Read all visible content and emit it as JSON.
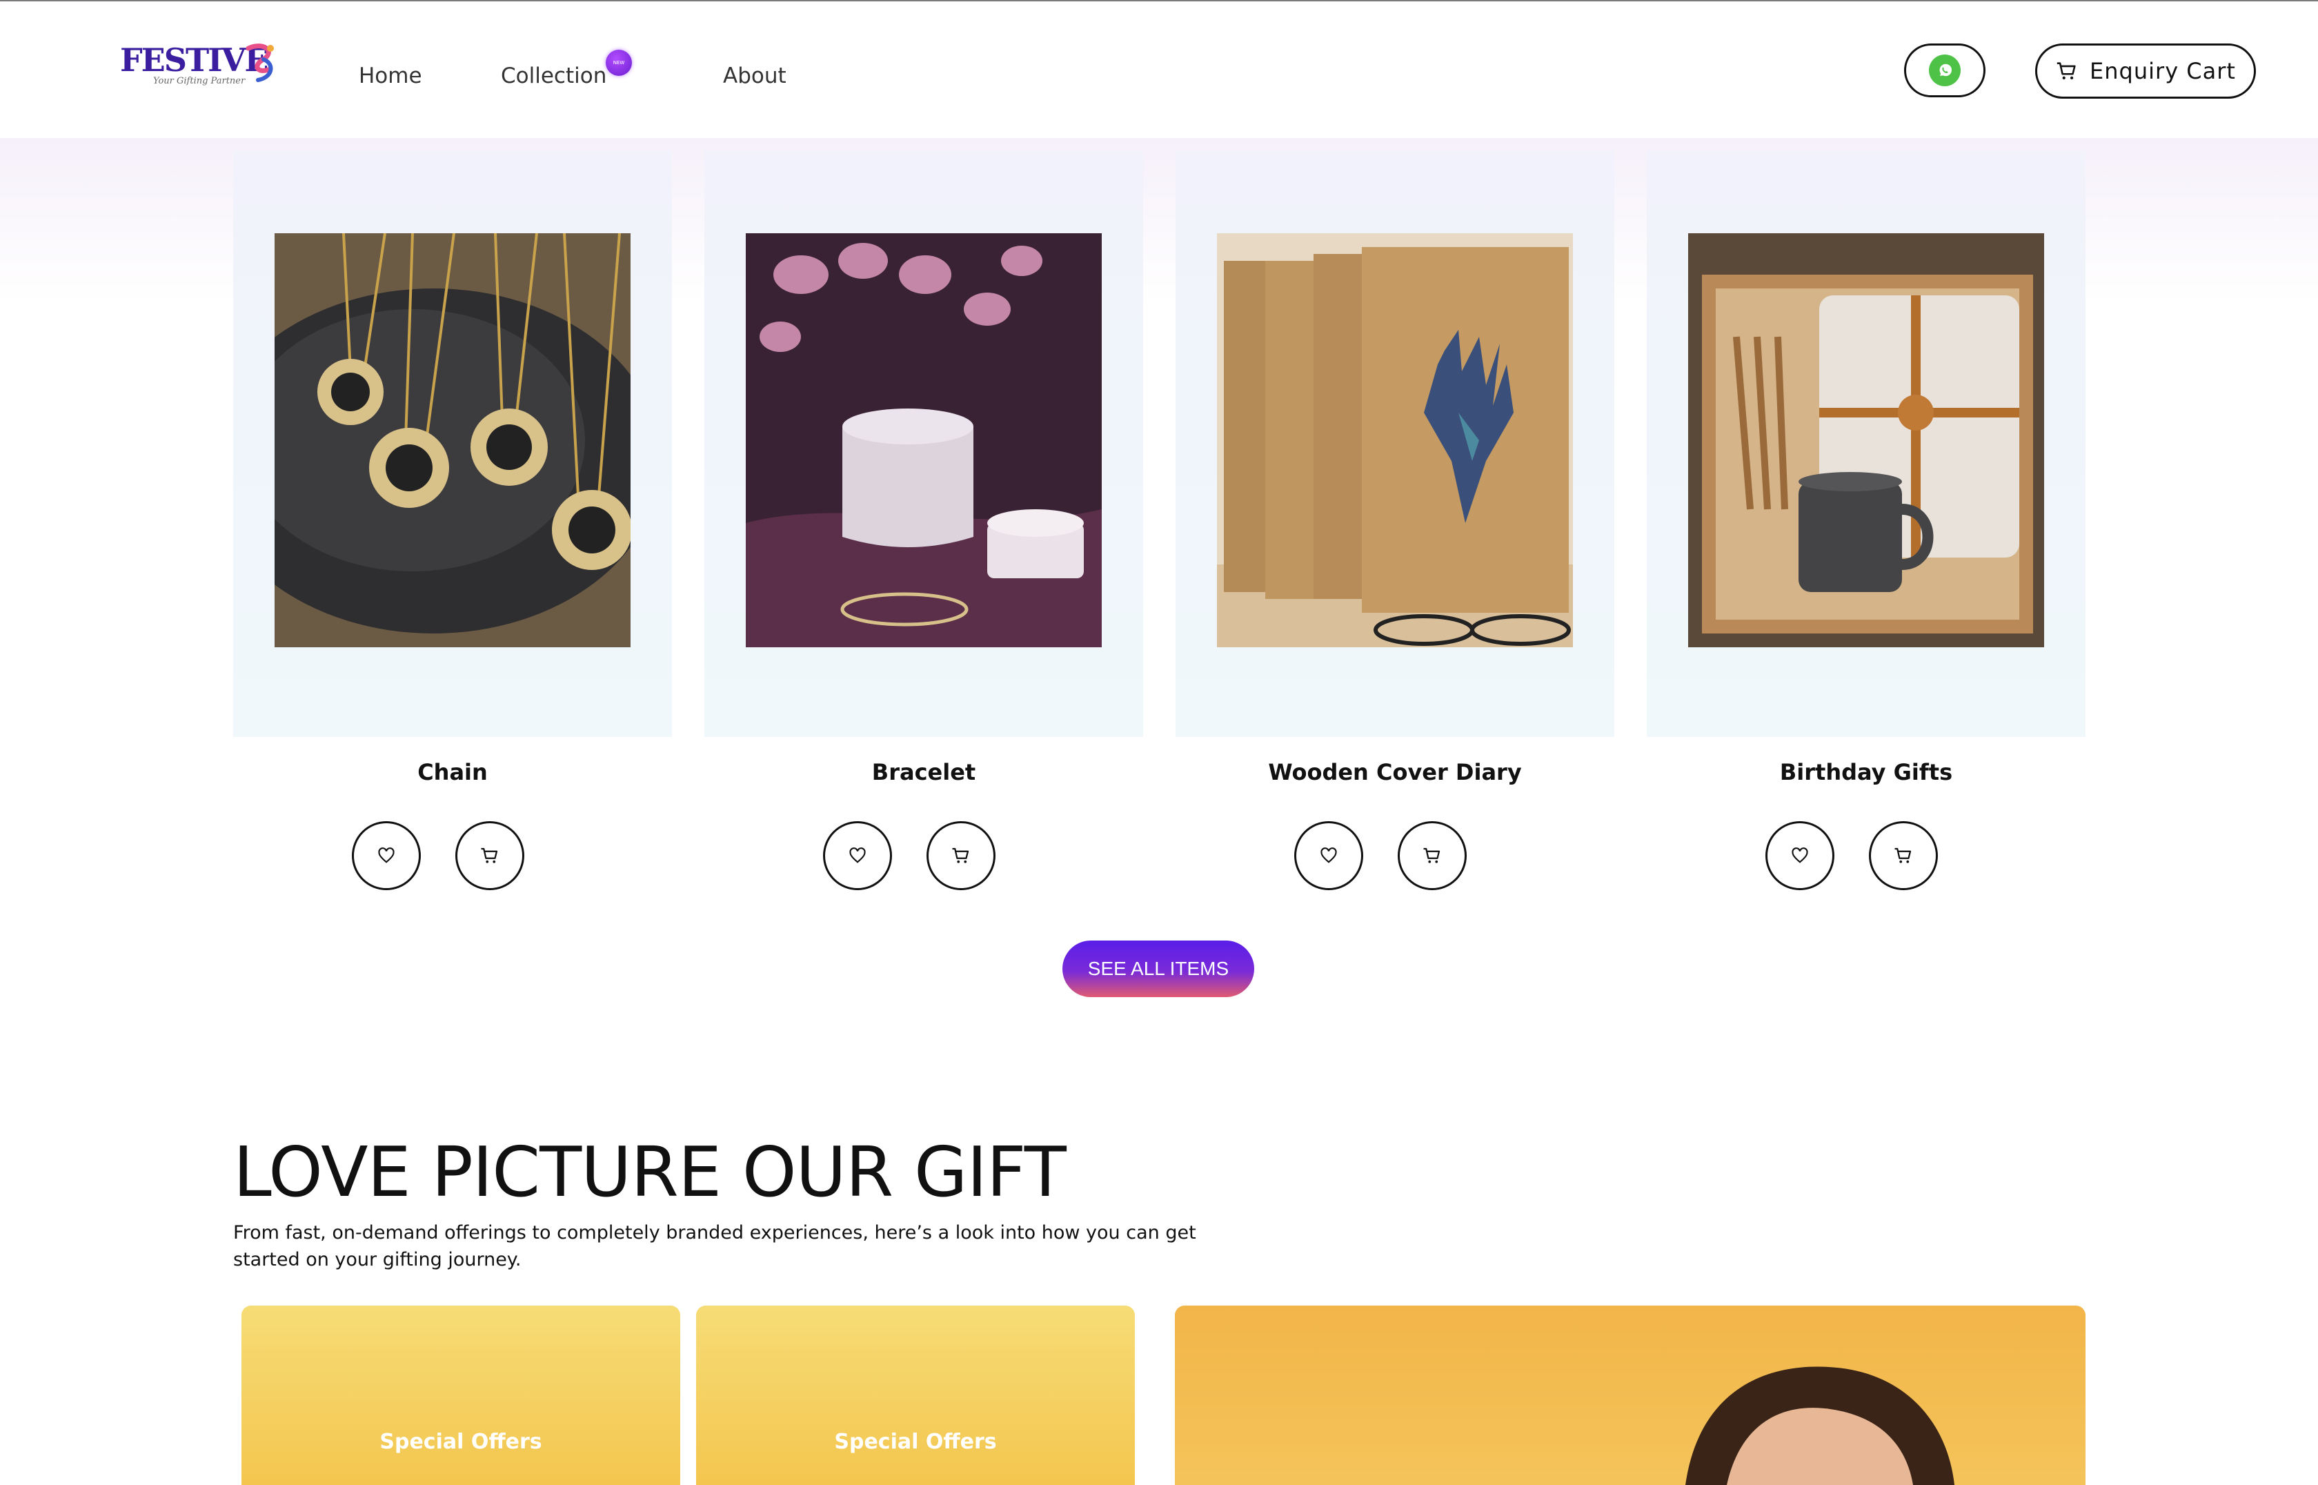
{
  "brand": {
    "name": "FESTIVE",
    "tagline": "Your Gifting Partner"
  },
  "nav": {
    "home": "Home",
    "collection": "Collection",
    "collection_badge": "NEW",
    "about": "About"
  },
  "header_actions": {
    "whatsapp_icon": "whatsapp-icon",
    "enquiry_cart_label": "Enquiry Cart"
  },
  "products": [
    {
      "title": "Chain"
    },
    {
      "title": "Bracelet"
    },
    {
      "title": "Wooden Cover Diary"
    },
    {
      "title": "Birthday Gifts"
    }
  ],
  "see_all_label": "SEE ALL ITEMS",
  "section": {
    "title": "LOVE PICTURE OUR GIFT",
    "description": "From fast, on-demand offerings to completely branded experiences, here’s a look into how you can get started on your gifting journey."
  },
  "offers": [
    {
      "label": "Special Offers"
    },
    {
      "label": "Special Offers"
    }
  ],
  "colors": {
    "brand_purple": "#3b1ea0",
    "whatsapp_green": "#4dc247",
    "cta_gradient_start": "#5a1ee8",
    "cta_gradient_end": "#e05a70",
    "offer_yellow": "#f4c64f"
  }
}
